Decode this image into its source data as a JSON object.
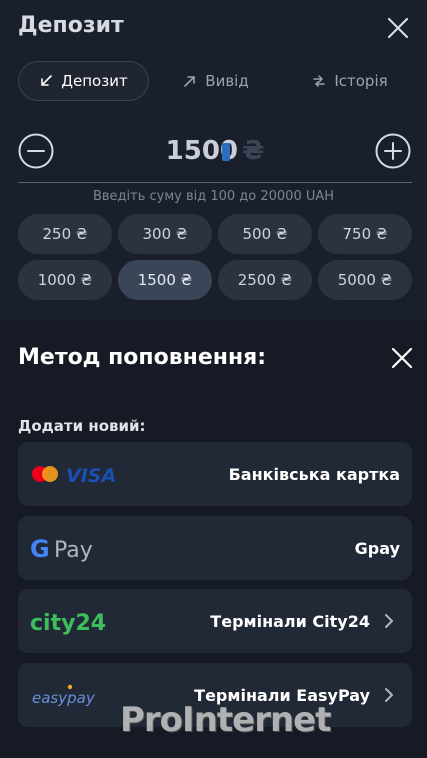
{
  "header": {
    "title": "Депозит"
  },
  "tabs": [
    {
      "label": "Депозит",
      "icon": "arrow-down-left-icon",
      "active": true
    },
    {
      "label": "Вивід",
      "icon": "arrow-up-right-icon",
      "active": false
    },
    {
      "label": "Історія",
      "icon": "history-arrows-icon",
      "active": false
    }
  ],
  "amount": {
    "value": "1500",
    "currency": "₴",
    "hint": "Введіть суму від 100 до 20000 UAH"
  },
  "presets": [
    {
      "label": "250 ₴",
      "selected": false
    },
    {
      "label": "300 ₴",
      "selected": false
    },
    {
      "label": "500 ₴",
      "selected": false
    },
    {
      "label": "750 ₴",
      "selected": false
    },
    {
      "label": "1000 ₴",
      "selected": false
    },
    {
      "label": "1500 ₴",
      "selected": true
    },
    {
      "label": "2500 ₴",
      "selected": false
    },
    {
      "label": "5000 ₴",
      "selected": false
    }
  ],
  "method": {
    "title": "Метод поповнення:",
    "add_label": "Додати новий:",
    "items": [
      {
        "label": "Банківська картка",
        "logo": "mastercard-visa-logo",
        "logo_text": "VISA",
        "chevron": false
      },
      {
        "label": "Gpay",
        "logo": "google-pay-logo",
        "logo_text": "G Pay",
        "chevron": false
      },
      {
        "label": "Термінали City24",
        "logo": "city24-logo",
        "logo_text": "city24",
        "chevron": true
      },
      {
        "label": "Термінали EasyPay",
        "logo": "easypay-logo",
        "logo_text": "easypay",
        "chevron": true
      }
    ]
  },
  "watermark": "ProInternet",
  "colors": {
    "background": "#151a25",
    "panel": "#1a202b",
    "chip": "#2c3340",
    "chip_selected": "#3a4558",
    "card": "#222936",
    "city24_green": "#3cbf5a",
    "visa_blue": "#1a4fb4"
  }
}
